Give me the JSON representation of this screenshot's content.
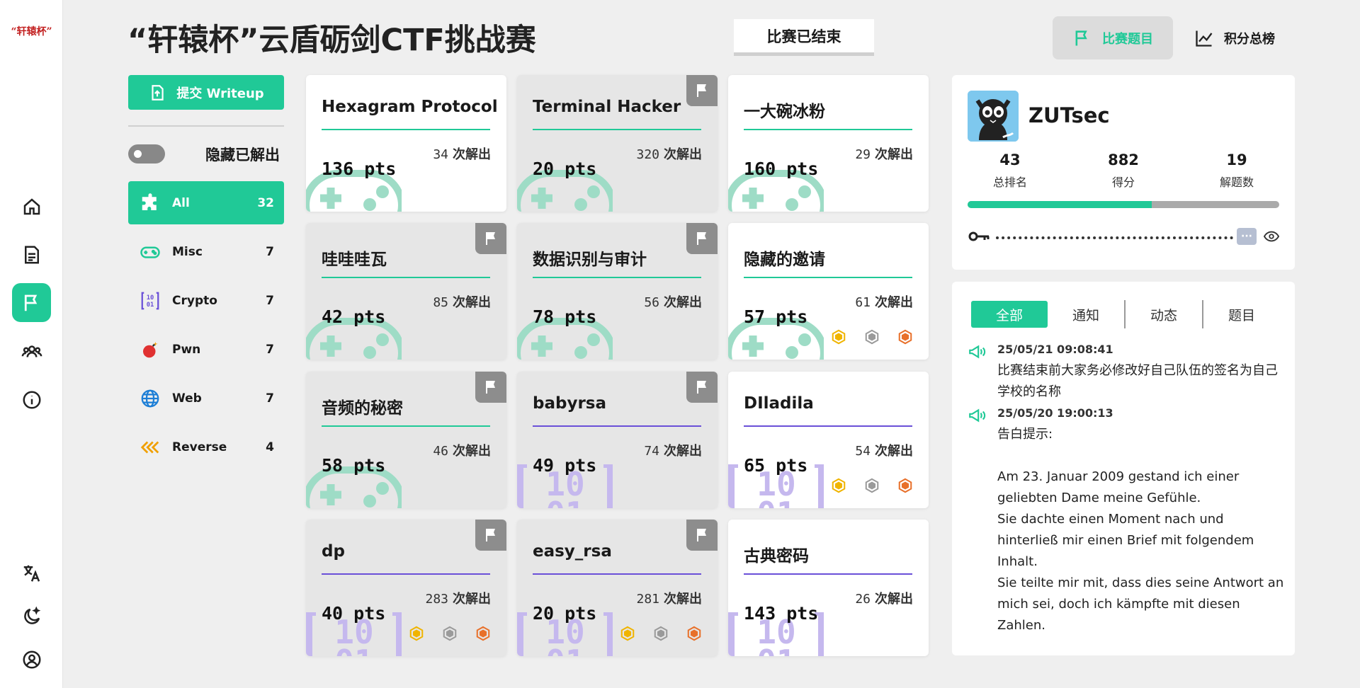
{
  "app": {
    "logo_text": "“轩辕杯”",
    "title": "“轩辕杯”云盾砺剑CTF挑战赛",
    "status": "比赛已结束"
  },
  "topnav": [
    {
      "label": "比赛题目",
      "icon": "flag-icon",
      "active": true
    },
    {
      "label": "积分总榜",
      "icon": "chart-line-icon",
      "active": false
    }
  ],
  "rail": [
    "home-icon",
    "document-icon",
    "flag-icon",
    "team-icon",
    "info-icon",
    "translate-icon",
    "theme-moon-icon",
    "account-icon"
  ],
  "sidebar": {
    "writeup_label": "提交 Writeup",
    "hide_solved_label": "隐藏已解出",
    "hide_solved_on": false,
    "categories": [
      {
        "name": "All",
        "count": "32",
        "icon": "puzzle-icon",
        "active": true
      },
      {
        "name": "Misc",
        "count": "7",
        "icon": "gamepad-icon"
      },
      {
        "name": "Crypto",
        "count": "7",
        "icon": "binary-icon"
      },
      {
        "name": "Pwn",
        "count": "7",
        "icon": "bomb-icon"
      },
      {
        "name": "Web",
        "count": "7",
        "icon": "globe-icon"
      },
      {
        "name": "Reverse",
        "count": "4",
        "icon": "rewind-icon"
      }
    ]
  },
  "challenges": [
    {
      "name": "Hexagram Protocol",
      "pts": "136 pts",
      "solves": "34",
      "solves_label": "次解出",
      "category": "Misc",
      "solved": false,
      "bloods": false
    },
    {
      "name": "Terminal Hacker",
      "pts": "20 pts",
      "solves": "320",
      "solves_label": "次解出",
      "category": "Misc",
      "solved": true,
      "bloods": false
    },
    {
      "name": "一大碗冰粉",
      "pts": "160 pts",
      "solves": "29",
      "solves_label": "次解出",
      "category": "Misc",
      "solved": false,
      "bloods": false
    },
    {
      "name": "哇哇哇瓦",
      "pts": "42 pts",
      "solves": "85",
      "solves_label": "次解出",
      "category": "Misc",
      "solved": true,
      "bloods": false
    },
    {
      "name": "数据识别与审计",
      "pts": "78 pts",
      "solves": "56",
      "solves_label": "次解出",
      "category": "Misc",
      "solved": true,
      "bloods": false
    },
    {
      "name": "隐藏的邀请",
      "pts": "57 pts",
      "solves": "61",
      "solves_label": "次解出",
      "category": "Misc",
      "solved": false,
      "bloods": true
    },
    {
      "name": "音频的秘密",
      "pts": "58 pts",
      "solves": "46",
      "solves_label": "次解出",
      "category": "Misc",
      "solved": true,
      "bloods": false
    },
    {
      "name": "babyrsa",
      "pts": "49 pts",
      "solves": "74",
      "solves_label": "次解出",
      "category": "Crypto",
      "solved": true,
      "bloods": false
    },
    {
      "name": "DIladila",
      "pts": "65 pts",
      "solves": "54",
      "solves_label": "次解出",
      "category": "Crypto",
      "solved": false,
      "bloods": true
    },
    {
      "name": "dp",
      "pts": "40 pts",
      "solves": "283",
      "solves_label": "次解出",
      "category": "Crypto",
      "solved": true,
      "bloods": true
    },
    {
      "name": "easy_rsa",
      "pts": "20 pts",
      "solves": "281",
      "solves_label": "次解出",
      "category": "Crypto",
      "solved": true,
      "bloods": true
    },
    {
      "name": "古典密码",
      "pts": "143 pts",
      "solves": "26",
      "solves_label": "次解出",
      "category": "Crypto",
      "solved": false,
      "bloods": false
    }
  ],
  "profile": {
    "team": "ZUTsec",
    "stats": [
      {
        "value": "43",
        "label": "总排名"
      },
      {
        "value": "882",
        "label": "得分"
      },
      {
        "value": "19",
        "label": "解题数"
      }
    ],
    "progress_fraction": 0.59,
    "token_mask": "···"
  },
  "news": {
    "tabs": [
      "全部",
      "通知",
      "动态",
      "题目"
    ],
    "active_tab": "全部",
    "items": [
      {
        "time": "25/05/21 09:08:41",
        "text": "比赛结束前大家务必修改好自己队伍的签名为自己学校的名称"
      },
      {
        "time": "25/05/20 19:00:13",
        "text": "告白提示:\n\nAm 23. Januar 2009 gestand ich einer geliebten Dame meine Gefühle.\nSie dachte einen Moment nach und hinterließ mir einen Brief mit folgendem Inhalt.\nSie teilte mir mit, dass dies seine Antwort an mich sei, doch ich kämpfte mit diesen Zahlen."
      }
    ]
  },
  "colors": {
    "accent": "#20c997",
    "crypto_rule": "#6a50d8",
    "gold": "#f0b400",
    "silver": "#9a9a9a",
    "bronze": "#e8702a"
  }
}
